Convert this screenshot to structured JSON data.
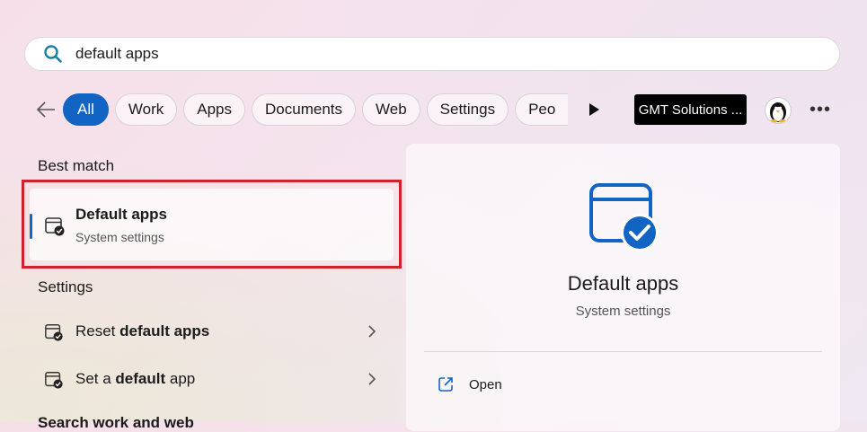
{
  "search": {
    "query": "default apps"
  },
  "filters": [
    "All",
    "Work",
    "Apps",
    "Documents",
    "Web",
    "Settings",
    "Peo"
  ],
  "account": {
    "label": "GMT Solutions ..."
  },
  "best_match": {
    "heading": "Best match",
    "title": "Default apps",
    "subtitle": "System settings"
  },
  "settings": {
    "heading": "Settings",
    "items": [
      {
        "prefix": "Reset ",
        "bold": "default apps",
        "suffix": ""
      },
      {
        "prefix": "Set a ",
        "bold": "default",
        "suffix": " app"
      }
    ]
  },
  "next_section_partial": "Search work and web",
  "preview": {
    "title": "Default apps",
    "subtitle": "System settings",
    "action_label": "Open"
  },
  "colors": {
    "accent": "#1264c4",
    "highlight_box": "#d4202a"
  }
}
